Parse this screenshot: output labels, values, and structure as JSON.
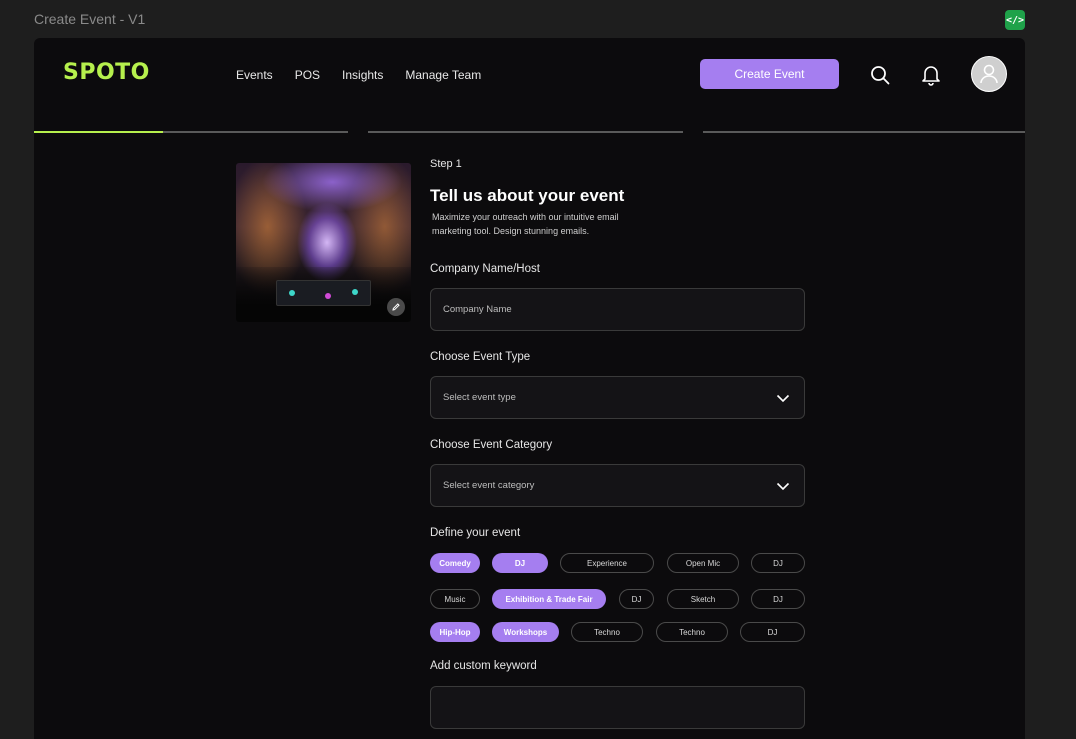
{
  "frame": {
    "title": "Create Event - V1",
    "code_badge": "</>"
  },
  "brand": {
    "logo": "SPOTO",
    "accent": "#b6f04d",
    "primary": "#a57ef0"
  },
  "nav": {
    "items": [
      "Events",
      "POS",
      "Insights",
      "Manage Team"
    ]
  },
  "header": {
    "create_button": "Create Event",
    "search_icon": "search-icon",
    "bell_icon": "bell-icon",
    "avatar_icon": "user-icon"
  },
  "progress": {
    "steps": 3,
    "current_step_fill": 0.41
  },
  "form": {
    "step": "Step 1",
    "title": "Tell us about your event",
    "subtitle": "Maximize your outreach with our intuitive email marketing tool. Design stunning emails.",
    "company_label": "Company Name/Host",
    "company_placeholder": "Company Name",
    "event_type_label": "Choose Event Type",
    "event_type_placeholder": "Select event type",
    "event_category_label": "Choose Event Category",
    "event_category_placeholder": "Select event category",
    "define_label": "Define your event",
    "keyword_label": "Add custom keyword"
  },
  "tags": {
    "row1": [
      {
        "label": "Comedy",
        "selected": true
      },
      {
        "label": "DJ",
        "selected": true
      },
      {
        "label": "Experience",
        "selected": false
      },
      {
        "label": "Open Mic",
        "selected": false
      },
      {
        "label": "DJ",
        "selected": false
      }
    ],
    "row2": [
      {
        "label": "Music",
        "selected": false
      },
      {
        "label": "Exhibition & Trade Fair",
        "selected": true
      },
      {
        "label": "DJ",
        "selected": false
      },
      {
        "label": "Sketch",
        "selected": false
      },
      {
        "label": "DJ",
        "selected": false
      }
    ],
    "row3": [
      {
        "label": "Hip-Hop",
        "selected": true
      },
      {
        "label": "Workshops",
        "selected": true
      },
      {
        "label": "Techno",
        "selected": false
      },
      {
        "label": "Techno",
        "selected": false
      },
      {
        "label": "DJ",
        "selected": false
      }
    ]
  }
}
